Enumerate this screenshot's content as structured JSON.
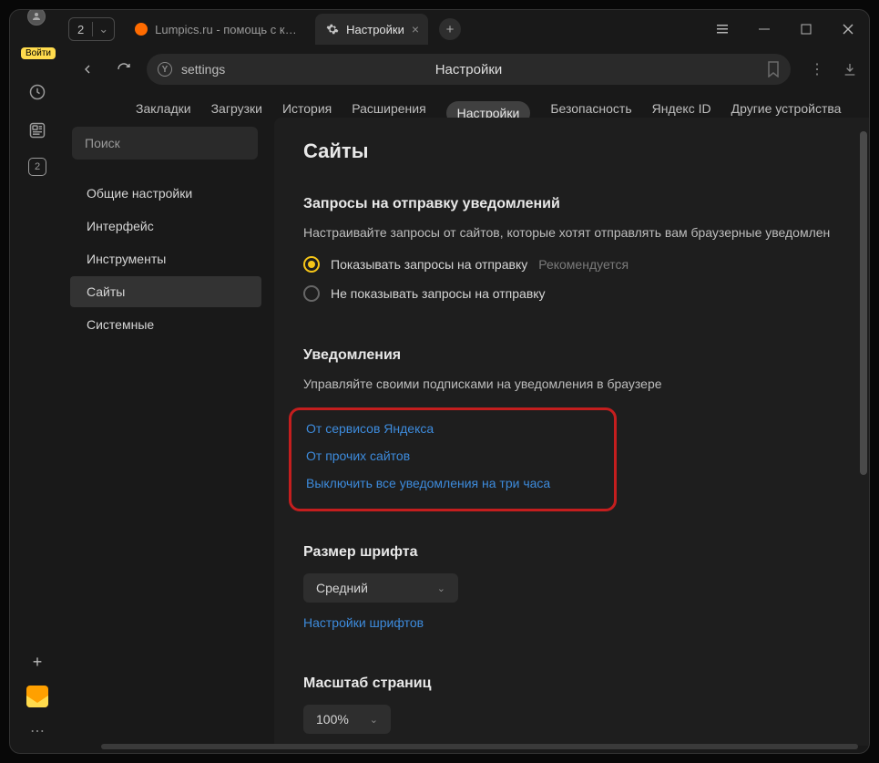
{
  "titlebar": {
    "login_label": "Войти",
    "tab_count": "2",
    "inactive_tab": {
      "title": "Lumpics.ru - помощь с ком"
    },
    "active_tab": {
      "title": "Настройки"
    }
  },
  "addressbar": {
    "yandex_letter": "Y",
    "url": "settings",
    "page_title": "Настройки"
  },
  "left_rail": {
    "box_number": "2"
  },
  "topnav": {
    "items": [
      "Закладки",
      "Загрузки",
      "История",
      "Расширения",
      "Настройки",
      "Безопасность",
      "Яндекс ID",
      "Другие устройства"
    ],
    "active_index": 4
  },
  "sidebar": {
    "search_placeholder": "Поиск",
    "items": [
      "Общие настройки",
      "Интерфейс",
      "Инструменты",
      "Сайты",
      "Системные"
    ],
    "active_index": 3
  },
  "main": {
    "heading": "Сайты",
    "notify_requests": {
      "title": "Запросы на отправку уведомлений",
      "desc": "Настраивайте запросы от сайтов, которые хотят отправлять вам браузерные уведомлен",
      "opt_show": "Показывать запросы на отправку",
      "opt_show_hint": "Рекомендуется",
      "opt_hide": "Не показывать запросы на отправку"
    },
    "notifications": {
      "title": "Уведомления",
      "desc": "Управляйте своими подписками на уведомления в браузере",
      "link_yandex": "От сервисов Яндекса",
      "link_other": "От прочих сайтов",
      "link_disable": "Выключить все уведомления на три часа"
    },
    "font": {
      "title": "Размер шрифта",
      "value": "Средний",
      "settings_link": "Настройки шрифтов"
    },
    "scale": {
      "title": "Масштаб страниц",
      "value": "100%"
    }
  }
}
